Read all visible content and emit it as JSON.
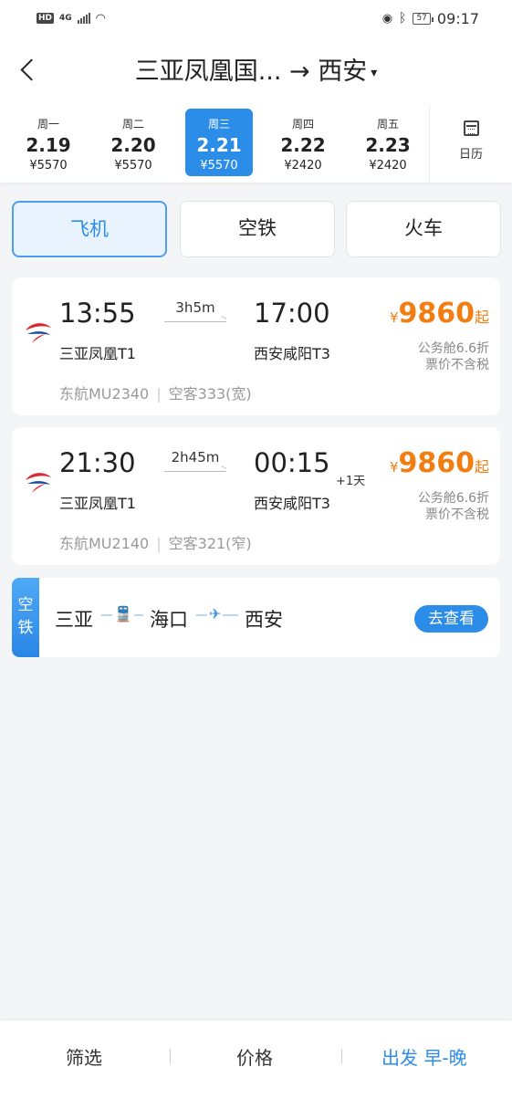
{
  "status_bar": {
    "hd": "HD",
    "network": "4G",
    "battery": "57",
    "time": "09:17"
  },
  "header": {
    "title": "三亚凤凰国... → 西安"
  },
  "dates": [
    {
      "dow": "周一",
      "day": "2.19",
      "price": "¥5570",
      "active": false
    },
    {
      "dow": "周二",
      "day": "2.20",
      "price": "¥5570",
      "active": false
    },
    {
      "dow": "周三",
      "day": "2.21",
      "price": "¥5570",
      "active": true
    },
    {
      "dow": "周四",
      "day": "2.22",
      "price": "¥2420",
      "active": false
    },
    {
      "dow": "周五",
      "day": "2.23",
      "price": "¥2420",
      "active": false
    }
  ],
  "calendar_label": "日历",
  "modes": [
    {
      "label": "飞机",
      "active": true
    },
    {
      "label": "空铁",
      "active": false
    },
    {
      "label": "火车",
      "active": false
    }
  ],
  "flights": [
    {
      "dep_time": "13:55",
      "duration": "3h5m",
      "arr_time": "17:00",
      "plus_day": "",
      "dep_airport": "三亚凤凰T1",
      "arr_airport": "西安咸阳T3",
      "airline_flight": "东航MU2340",
      "aircraft": "空客333(宽)",
      "price_currency": "¥",
      "price": "9860",
      "price_suffix": "起",
      "cabin": "公务舱6.6折",
      "tax_note": "票价不含税"
    },
    {
      "dep_time": "21:30",
      "duration": "2h45m",
      "arr_time": "00:15",
      "plus_day": "+1天",
      "dep_airport": "三亚凤凰T1",
      "arr_airport": "西安咸阳T3",
      "airline_flight": "东航MU2140",
      "aircraft": "空客321(窄)",
      "price_currency": "¥",
      "price": "9860",
      "price_suffix": "起",
      "cabin": "公务舱6.6折",
      "tax_note": "票价不含税"
    }
  ],
  "combo": {
    "tag": "空铁",
    "stop1": "三亚",
    "stop2": "海口",
    "stop3": "西安",
    "button": "去查看"
  },
  "bottom_bar": {
    "filter": "筛选",
    "price": "价格",
    "depart": "出发 早-晚"
  },
  "colors": {
    "accent": "#2c8de8",
    "price": "#f27d11",
    "airline_red": "#d7282f",
    "airline_blue": "#1b4f9c"
  },
  "icons": {
    "back": "chevron-left-icon",
    "calendar": "calendar-icon",
    "airline": "china-eastern-logo-icon",
    "train": "train-icon",
    "plane": "plane-icon"
  }
}
